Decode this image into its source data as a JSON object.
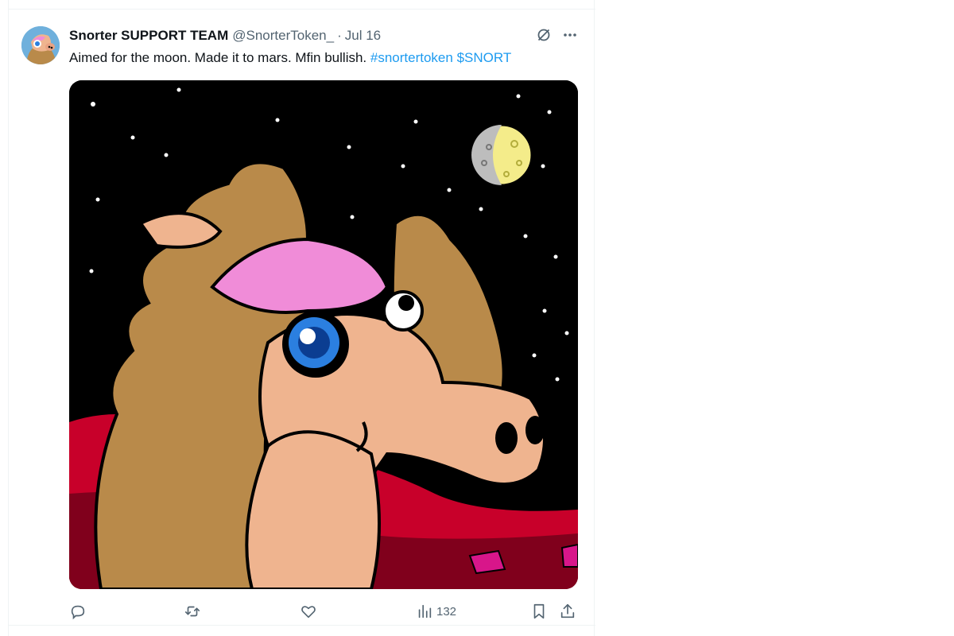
{
  "tweet": {
    "display_name": "Snorter SUPPORT TEAM",
    "handle": "@SnorterToken_",
    "separator": "·",
    "date": "Jul 16",
    "text_plain": "Aimed for the moon. Made it to mars. Mfin bullish.",
    "hashtag": "#snortertoken",
    "cashtag": "$SNORT",
    "media_alt": "cartoon horse on mars with moon",
    "views": "132"
  },
  "icons": {
    "avatar": "avatar",
    "grok": "grok-icon",
    "more": "more-icon",
    "reply": "reply-icon",
    "retweet": "retweet-icon",
    "like": "like-icon",
    "views": "views-icon",
    "bookmark": "bookmark-icon",
    "share": "share-icon"
  },
  "colors": {
    "link": "#1d9bf0",
    "secondary_text": "#536471",
    "divider": "#eff3f4"
  }
}
